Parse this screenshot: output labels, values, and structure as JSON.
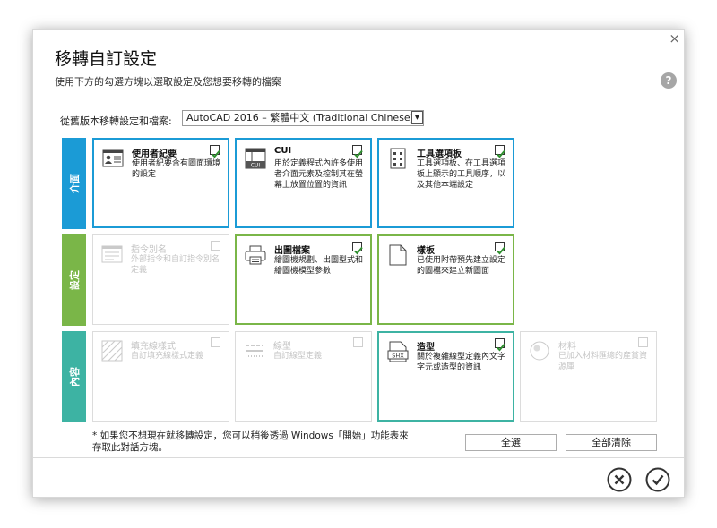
{
  "dialog": {
    "title": "移轉自訂設定",
    "subtitle": "使用下方的勾選方塊以選取設定及您想要移轉的檔案",
    "help_label": "?",
    "close_label": "×"
  },
  "source": {
    "label": "從舊版本移轉設定和檔案:",
    "selected": "AutoCAD 2016 – 繁體中文 (Traditional Chinese) -"
  },
  "categories": [
    {
      "label": "介面",
      "color": "#1b9bd6"
    },
    {
      "label": "設定",
      "color": "#7ab648"
    },
    {
      "label": "內容",
      "color": "#3db3a3"
    }
  ],
  "cards": [
    {
      "title": "使用者紀要",
      "desc": "使用者紀要含有圖面環境的設定",
      "icon": "user-profile-icon",
      "enabled": true,
      "checked": true
    },
    {
      "title": "CUI",
      "desc": "用於定義程式內許多使用者介面元素及控制其在螢幕上放置位置的資訊",
      "icon": "cui-icon",
      "enabled": true,
      "checked": true
    },
    {
      "title": "工具選項板",
      "desc": "工具選項板、在工具選項板上顯示的工具順序，以及其他本端設定",
      "icon": "tool-palette-icon",
      "enabled": true,
      "checked": true
    },
    {
      "title": "指令別名",
      "desc": "外部指令和自訂指令別名定義",
      "icon": "command-alias-icon",
      "enabled": false,
      "checked": false
    },
    {
      "title": "出圖檔案",
      "desc": "繪圖機規劃、出圖型式和繪圖機模型參數",
      "icon": "printer-icon",
      "enabled": true,
      "checked": true
    },
    {
      "title": "樣板",
      "desc": "已使用附帶預先建立設定的圖檔來建立新圖面",
      "icon": "template-icon",
      "enabled": true,
      "checked": true
    },
    {
      "title": "填充線樣式",
      "desc": "自訂填充線樣式定義",
      "icon": "hatch-pattern-icon",
      "enabled": false,
      "checked": false
    },
    {
      "title": "線型",
      "desc": "自訂線型定義",
      "icon": "linetype-icon",
      "enabled": false,
      "checked": false
    },
    {
      "title": "造型",
      "desc": "關於複雜線型定義內文字字元或造型的資訊",
      "icon": "shx-shape-icon",
      "enabled": true,
      "checked": true
    },
    {
      "title": "材料",
      "desc": "已加入材料匯總的產賞資源庫",
      "icon": "material-icon",
      "enabled": false,
      "checked": false
    }
  ],
  "note": "* 如果您不想現在就移轉設定，您可以稍後透過 Windows「開始」功能表來存取此對話方塊。",
  "buttons": {
    "select_all": "全選",
    "clear_all": "全部清除"
  }
}
